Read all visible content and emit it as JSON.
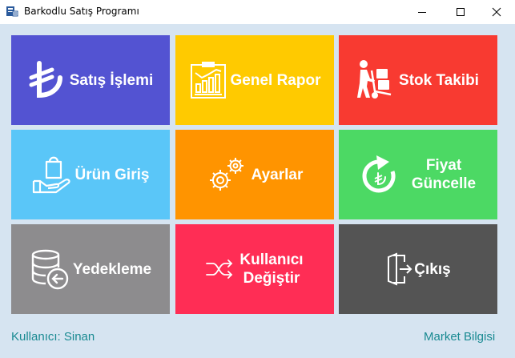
{
  "window": {
    "title": "Barkodlu Satış Programı"
  },
  "tiles": [
    {
      "label": "Satış İşlemi",
      "color": "#5353d2",
      "icon": "lira-icon"
    },
    {
      "label": "Genel Rapor",
      "color": "#ffca00",
      "icon": "report-icon"
    },
    {
      "label": "Stok Takibi",
      "color": "#f83a31",
      "icon": "hand-truck-icon"
    },
    {
      "label": "Ürün Giriş",
      "color": "#5ac6f8",
      "icon": "hand-bag-icon"
    },
    {
      "label": "Ayarlar",
      "color": "#ff9400",
      "icon": "gears-icon"
    },
    {
      "label_line1": "Fiyat",
      "label_line2": "Güncelle",
      "color": "#4cd964",
      "icon": "price-refresh-icon"
    },
    {
      "label": "Yedekleme",
      "color": "#8d8c8e",
      "icon": "database-backup-icon"
    },
    {
      "label_line1": "Kullanıcı",
      "label_line2": "Değiştir",
      "color": "#ff2d55",
      "icon": "shuffle-icon"
    },
    {
      "label": "Çıkış",
      "color": "#545454",
      "icon": "exit-door-icon"
    }
  ],
  "footer": {
    "user_text": "Kullanıcı: Sinan",
    "market_link": "Market Bilgisi"
  }
}
